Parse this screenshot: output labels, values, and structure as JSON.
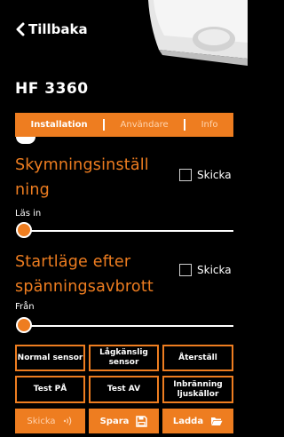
{
  "header": {
    "back_label": "Tillbaka",
    "title": "HF 3360"
  },
  "tabs": [
    {
      "label": "Installation",
      "active": true
    },
    {
      "label": "Användare",
      "active": false
    },
    {
      "label": "Info",
      "active": false
    }
  ],
  "settings": [
    {
      "title_line1": "Skymningsinställ",
      "title_line2": "ning",
      "send_label": "Skicka",
      "send_checked": false,
      "value_label": "Läs in",
      "slider_level": 0
    },
    {
      "title_line1": "Startläge efter",
      "title_line2": "spänningsavbrott",
      "send_label": "Skicka",
      "send_checked": false,
      "value_label": "Från",
      "slider_level": 0
    }
  ],
  "buttons": {
    "normal_sensor": "Normal sensor",
    "low_sensitive_line1": "Lågkänslig",
    "low_sensitive_line2": "sensor",
    "reset": "Återställ",
    "test_on": "Test PÅ",
    "test_off": "Test AV",
    "burn_in_line1": "Inbränning",
    "burn_in_line2": "ljuskällor"
  },
  "bottom": {
    "send_label": "Skicka",
    "save_label": "Spara",
    "load_label": "Ladda"
  },
  "colors": {
    "accent": "#ee7d20",
    "background": "#000000",
    "text": "#ffffff"
  },
  "icons": {
    "back": "chevron-left-icon",
    "send": "wireless-signal-icon",
    "save": "floppy-disk-icon",
    "load": "folder-icon"
  }
}
